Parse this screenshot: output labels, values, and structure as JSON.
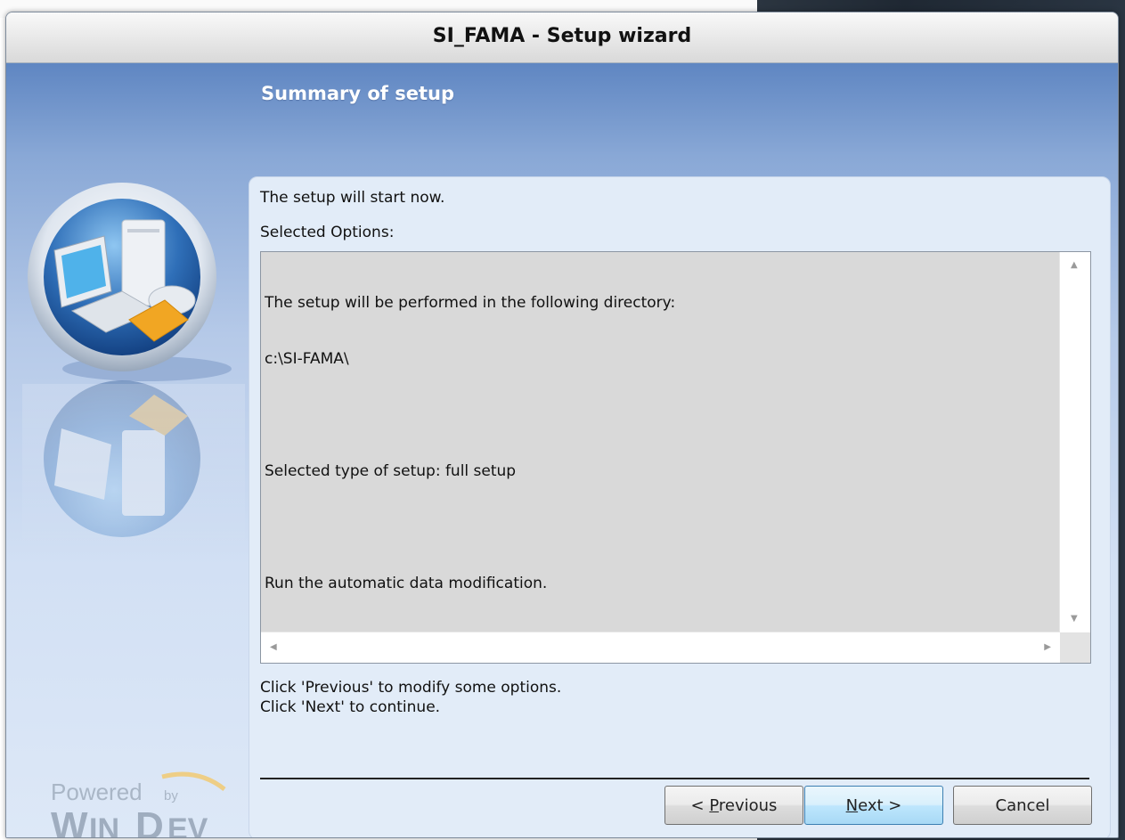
{
  "window": {
    "title": "SI_FAMA - Setup wizard"
  },
  "header": {
    "title": "Summary of setup"
  },
  "body": {
    "intro": "The setup will start now.",
    "options_label": "Selected Options:",
    "options_text_lines": [
      "The setup will be performed in the following directory:",
      "c:\\SI-FAMA\\",
      "",
      "Selected type of setup: full setup",
      "",
      "Run the automatic data modification."
    ],
    "hint_line_1": "Click 'Previous' to modify some options.",
    "hint_line_2": "Click 'Next' to continue."
  },
  "buttons": {
    "previous_prefix": "< ",
    "previous_accel": "P",
    "previous_rest": "revious",
    "next_accel": "N",
    "next_rest": "ext >",
    "cancel": "Cancel"
  },
  "branding": {
    "powered_line": "Powered by",
    "product": "WINDEV"
  },
  "icons": {
    "setup": "computer-setup-icon",
    "scroll_up": "scroll-up-arrow-icon",
    "scroll_down": "scroll-down-arrow-icon",
    "scroll_left": "scroll-left-arrow-icon",
    "scroll_right": "scroll-right-arrow-icon"
  },
  "colors": {
    "header_blue": "#5f86c2",
    "panel_bg": "#e2ecf8",
    "textarea_bg": "#d9d9d9",
    "default_button": "#bee6fd"
  }
}
